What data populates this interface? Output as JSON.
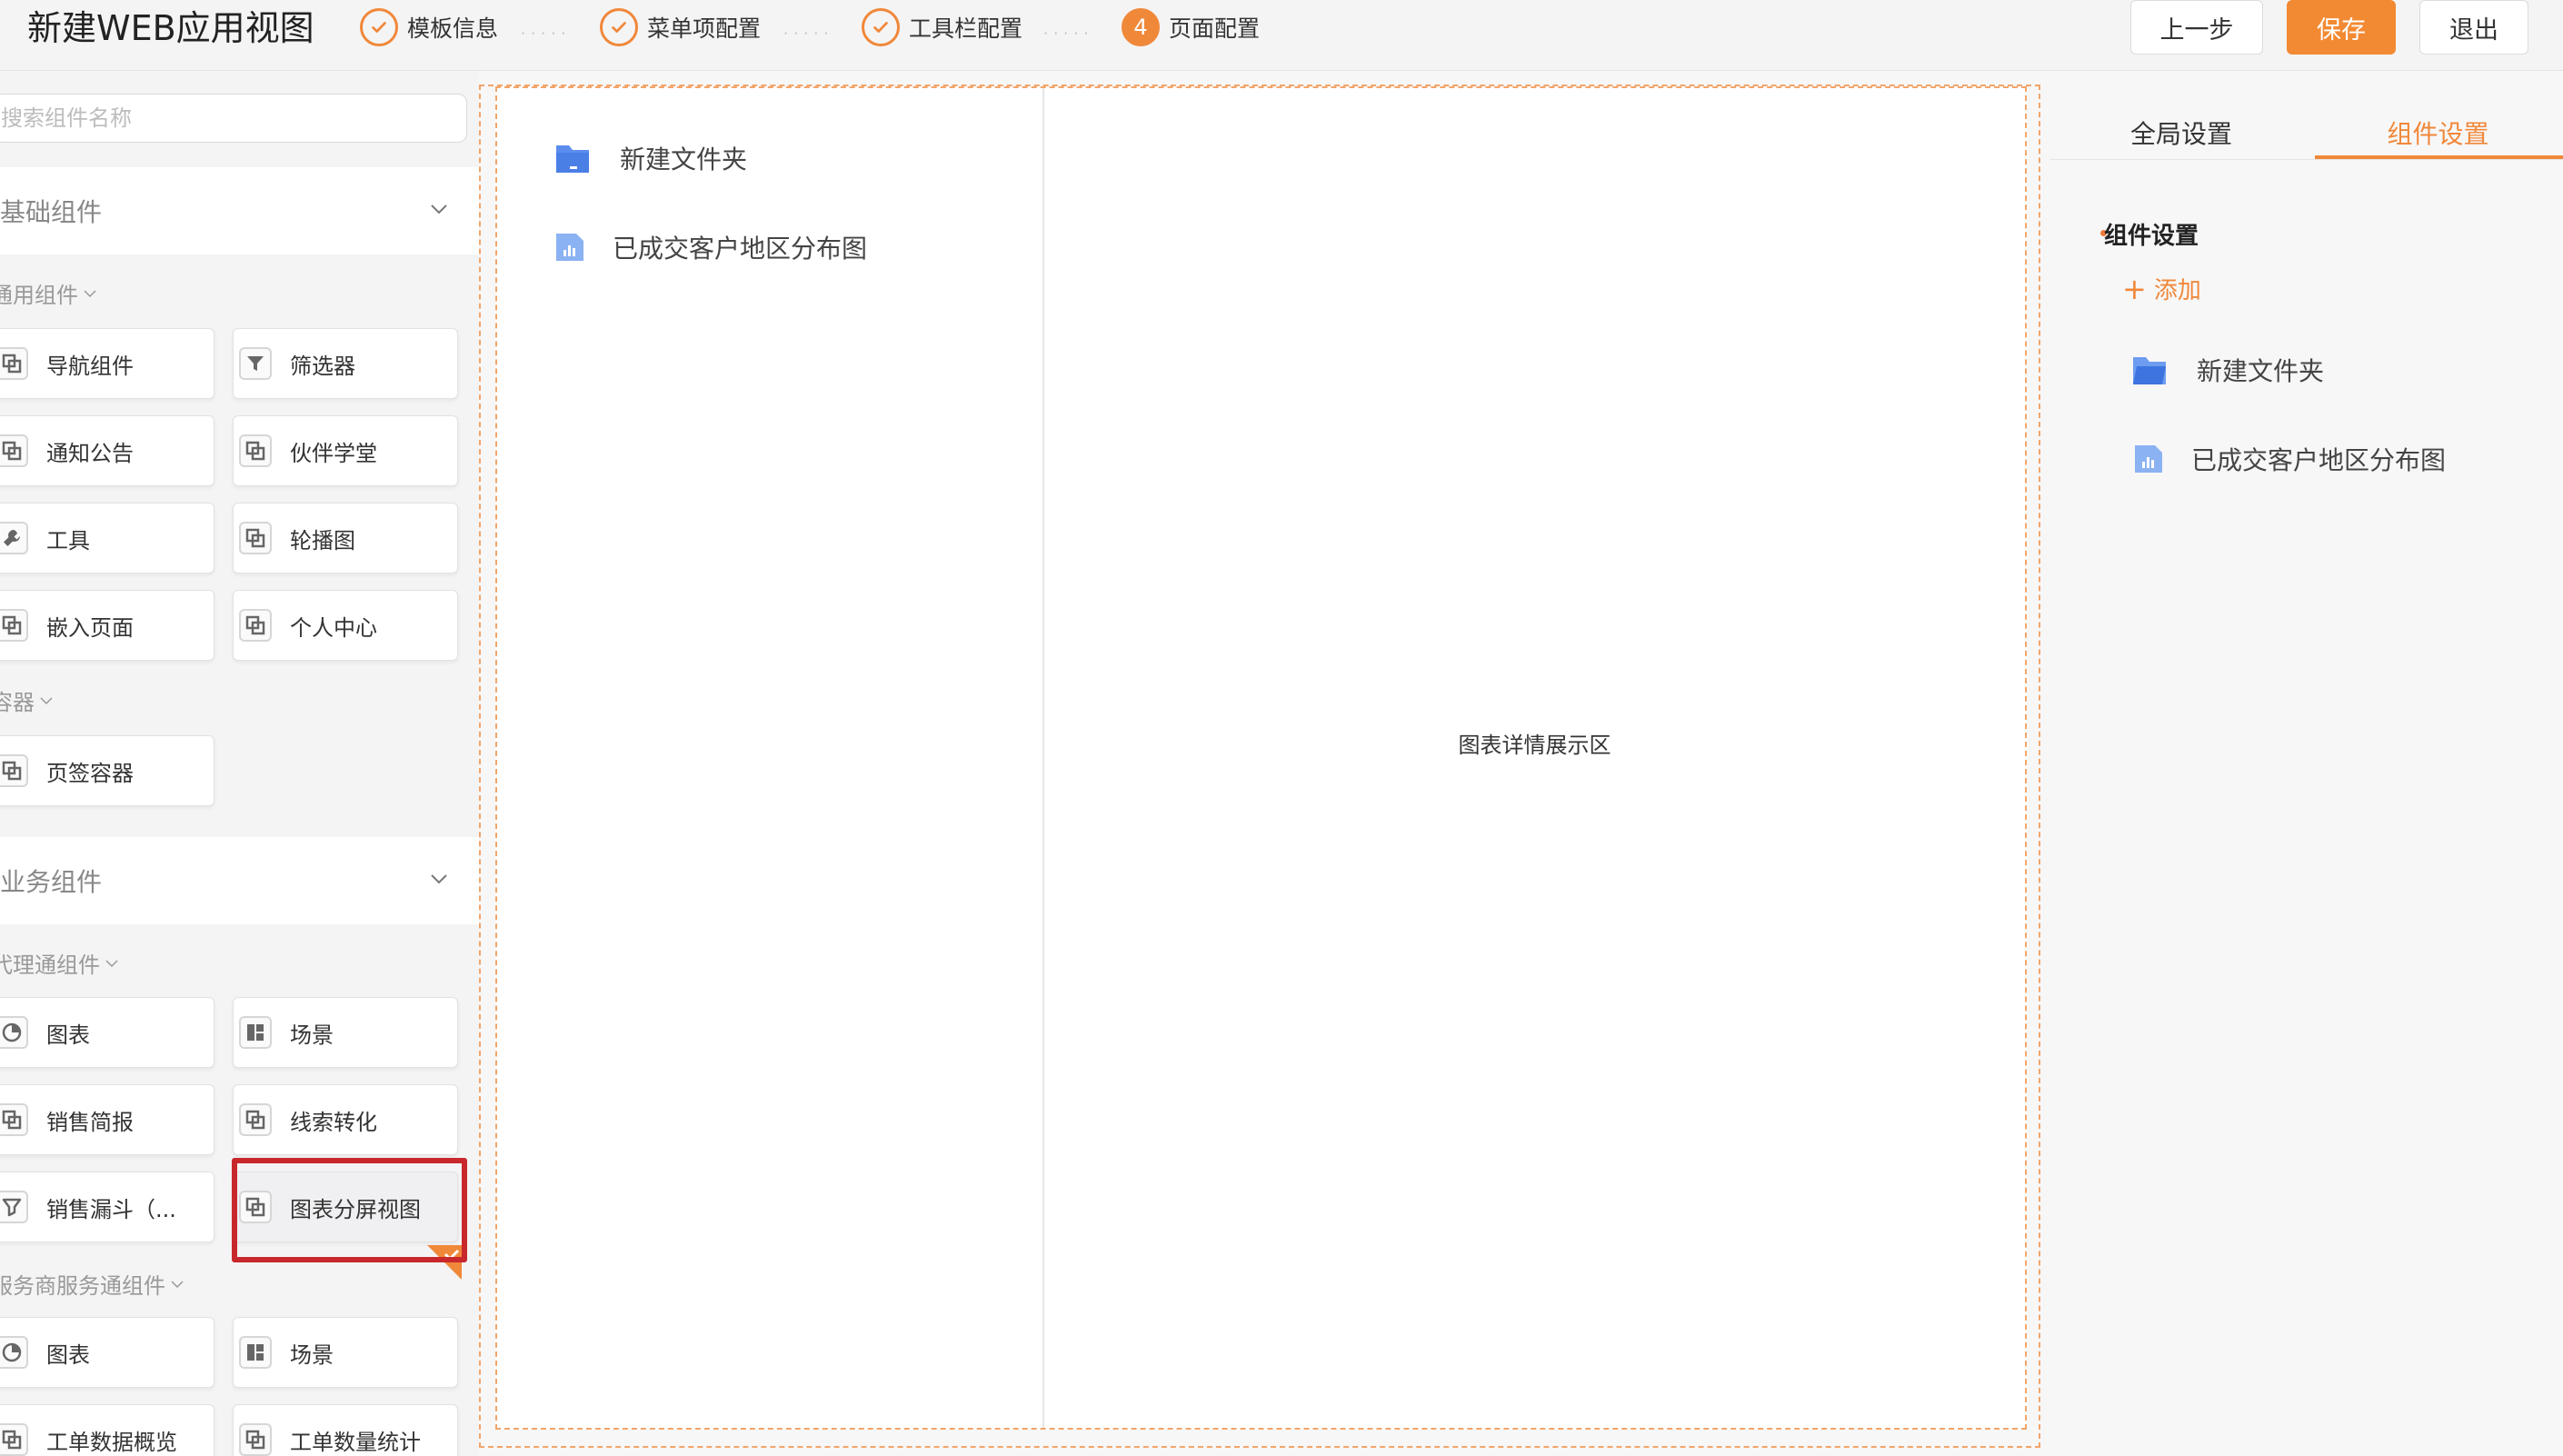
{
  "header": {
    "title": "新建WEB应用视图",
    "steps": [
      {
        "label": "模板信息",
        "state": "done"
      },
      {
        "label": "菜单项配置",
        "state": "done"
      },
      {
        "label": "工具栏配置",
        "state": "done"
      },
      {
        "label": "页面配置",
        "state": "active",
        "number": "4"
      }
    ],
    "buttons": {
      "prev": "上一步",
      "save": "保存",
      "exit": "退出"
    }
  },
  "sidebar": {
    "search_placeholder": "搜索组件名称",
    "basic": {
      "title": "基础组件",
      "common_label": "通用组件",
      "common_items": [
        "导航组件",
        "筛选器",
        "通知公告",
        "伙伴学堂",
        "工具",
        "轮播图",
        "嵌入页面",
        "个人中心"
      ],
      "container_label": "容器",
      "container_items": [
        "页签容器"
      ]
    },
    "business": {
      "title": "业务组件",
      "agent_label": "代理通组件",
      "agent_items": [
        "图表",
        "场景",
        "销售简报",
        "线索转化",
        "销售漏斗（...",
        "图表分屏视图"
      ],
      "service_label": "服务商服务通组件",
      "service_items": [
        "图表",
        "场景",
        "工单数据概览",
        "工单数量统计"
      ]
    }
  },
  "canvas": {
    "menu_items": [
      "新建文件夹",
      "已成交客户地区分布图"
    ],
    "detail_placeholder": "图表详情展示区"
  },
  "right_panel": {
    "tabs": [
      "全局设置",
      "组件设置"
    ],
    "active_tab": "组件设置",
    "section_title": "组件设置",
    "add_label": "添加",
    "items": [
      "新建文件夹",
      "已成交客户地区分布图"
    ]
  },
  "colors": {
    "accent": "#f0883a",
    "save_button": "#f28a33",
    "highlight": "#c8282c",
    "folder_icon": "#5b8def"
  }
}
